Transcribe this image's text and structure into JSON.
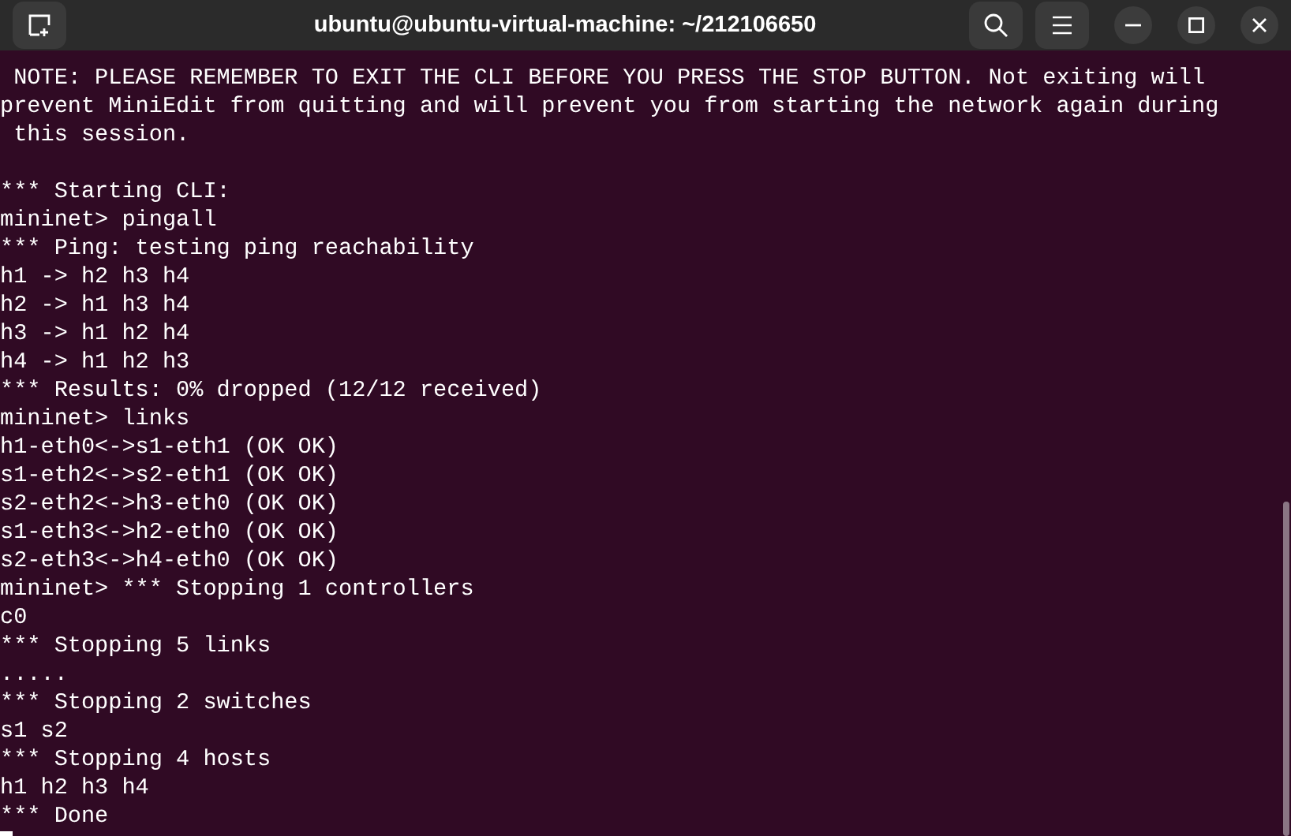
{
  "window": {
    "title": "ubuntu@ubuntu-virtual-machine: ~/212106650"
  },
  "terminal": {
    "blocks": [
      [
        " NOTE: PLEASE REMEMBER TO EXIT THE CLI BEFORE YOU PRESS THE STOP BUTTON. Not exiting will",
        "prevent MiniEdit from quitting and will prevent you from starting the network again during",
        " this session."
      ],
      [
        "*** Starting CLI:",
        "mininet> pingall",
        "*** Ping: testing ping reachability",
        "h1 -> h2 h3 h4",
        "h2 -> h1 h3 h4",
        "h3 -> h1 h2 h4",
        "h4 -> h1 h2 h3",
        "*** Results: 0% dropped (12/12 received)",
        "mininet> links",
        "h1-eth0<->s1-eth1 (OK OK)",
        "s1-eth2<->s2-eth1 (OK OK)",
        "s2-eth2<->h3-eth0 (OK OK)",
        "s1-eth3<->h2-eth0 (OK OK)",
        "s2-eth3<->h4-eth0 (OK OK)",
        "mininet> *** Stopping 1 controllers",
        "c0",
        "*** Stopping 5 links",
        ".....",
        "*** Stopping 2 switches",
        "s1 s2",
        "*** Stopping 4 hosts",
        "h1 h2 h3 h4",
        "*** Done"
      ]
    ]
  }
}
